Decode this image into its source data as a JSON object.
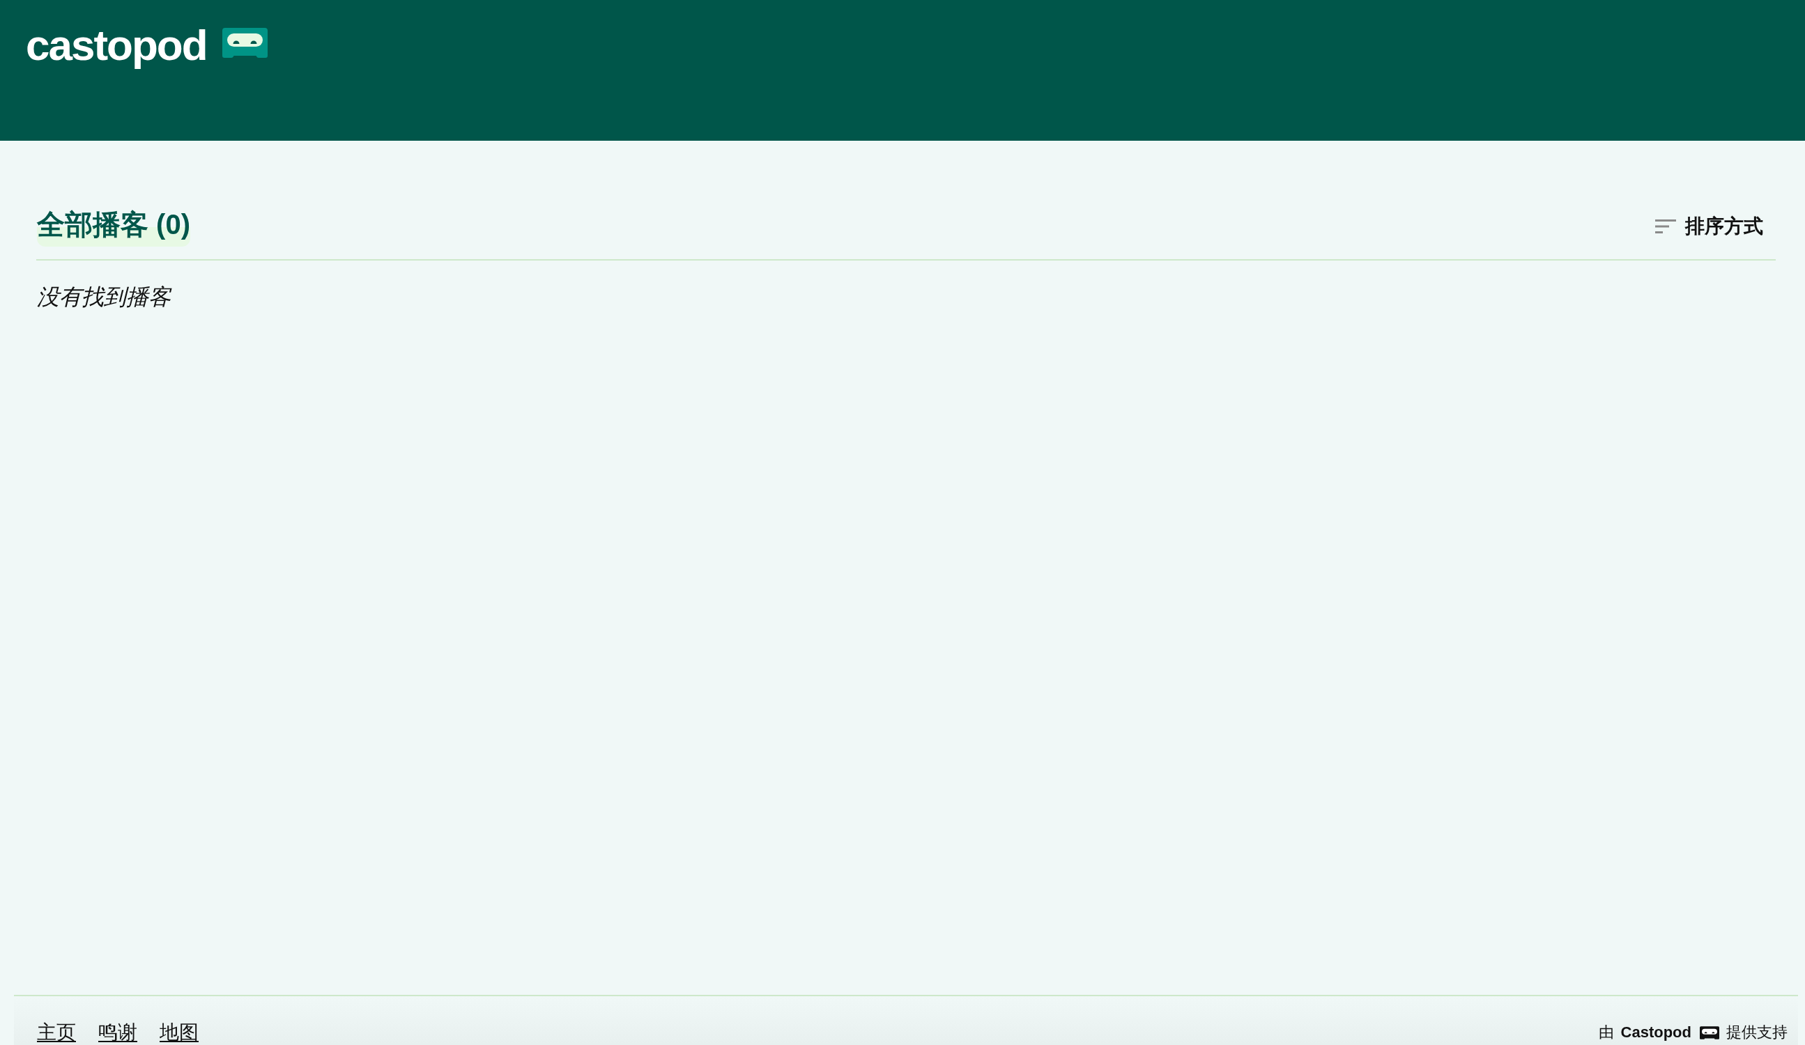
{
  "header": {
    "logo": {
      "text": "castopod"
    }
  },
  "main": {
    "title": "全部播客 (0)",
    "sort_button": {
      "label": "排序方式"
    },
    "empty_message": "没有找到播客"
  },
  "footer": {
    "links": [
      {
        "label": "主页"
      },
      {
        "label": "鸣谢"
      },
      {
        "label": "地图"
      }
    ],
    "powered_by": {
      "before": "由",
      "link": "Castopod",
      "after": "提供支持"
    }
  }
}
